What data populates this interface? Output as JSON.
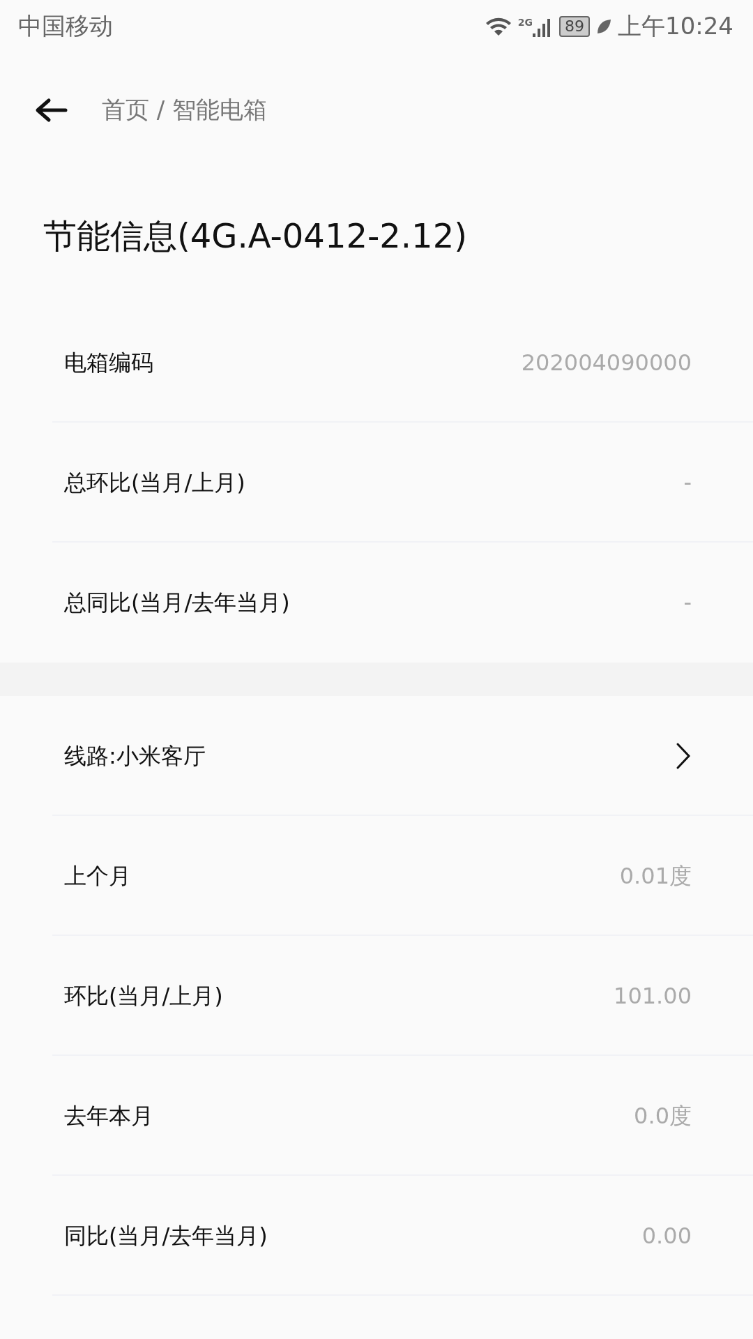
{
  "status_bar": {
    "carrier": "中国移动",
    "network": "2G",
    "battery": "89",
    "time": "上午10:24"
  },
  "header": {
    "breadcrumb": "首页 / 智能电箱"
  },
  "title": "节能信息(4G.A-0412-2.12)",
  "sections": [
    {
      "rows": [
        {
          "kind": "value",
          "label": "电箱编码",
          "value": "202004090000"
        },
        {
          "kind": "value",
          "label": "总环比(当月/上月)",
          "value": "-"
        },
        {
          "kind": "value",
          "label": "总同比(当月/去年当月)",
          "value": "-"
        }
      ]
    },
    {
      "rows": [
        {
          "kind": "link",
          "label": "线路:小米客厅"
        },
        {
          "kind": "value",
          "label": "上个月",
          "value": "0.01度"
        },
        {
          "kind": "value",
          "label": "环比(当月/上月)",
          "value": "101.00"
        },
        {
          "kind": "value",
          "label": "去年本月",
          "value": "0.0度"
        },
        {
          "kind": "value",
          "label": "同比(当月/去年当月)",
          "value": "0.00"
        }
      ]
    }
  ]
}
